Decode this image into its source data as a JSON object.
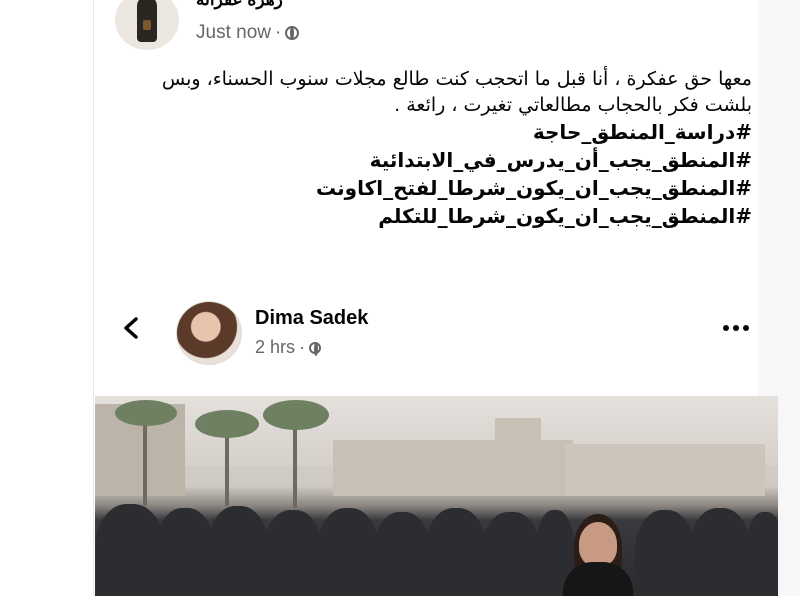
{
  "header": {
    "name": "زهرة عفراتة",
    "time": "Just now"
  },
  "post": {
    "paragraph": "معها حق عفكرة ، أنا قبل ما اتحجب كنت طالع مجلات سنوب الحسناء، وبس بلشت فكر بالحجاب مطالعاتي تغيرت ، رائعة .",
    "hashtags": [
      "#دراسة_المنطق_حاجة",
      "#المنطق_يجب_أن_يدرس_في_الابتدائية",
      "#المنطق_يجب_ان_يكون_شرطا_لفتح_اكاونت",
      "#المنطق_يجب_ان_يكون_شرطا_للتكلم"
    ]
  },
  "shared": {
    "name": "Dima Sadek",
    "time": "2 hrs",
    "icons": {
      "back": "chevron-left-icon",
      "more": "more-horizontal-icon",
      "privacy": "globe-icon"
    }
  }
}
